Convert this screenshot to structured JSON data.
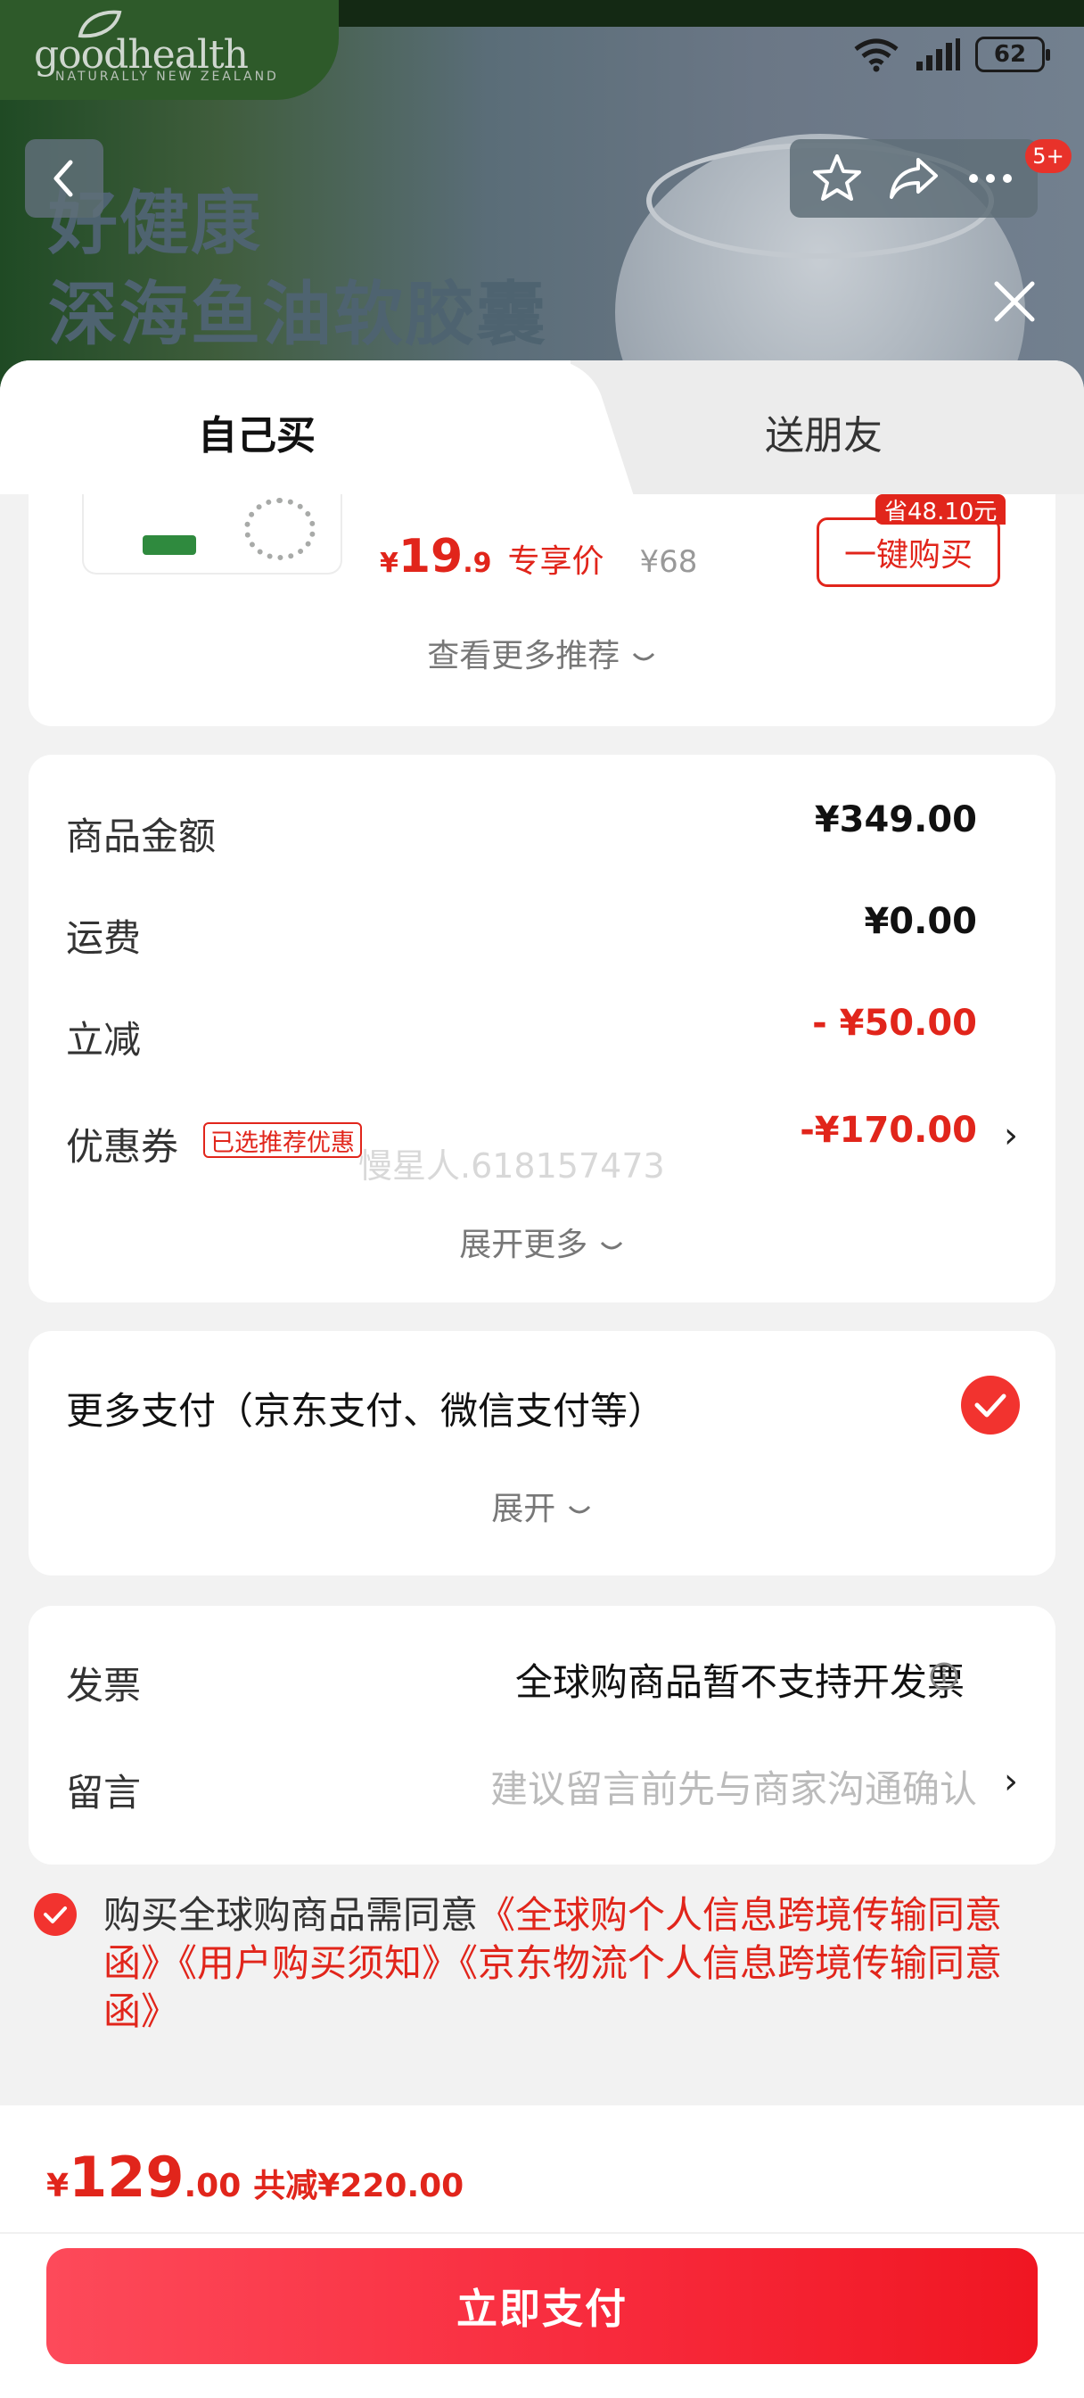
{
  "banner": {
    "brand": "goodhealth",
    "brand_sub": "NATURALLY NEW ZEALAND",
    "headline_line1": "好健康",
    "headline_line2": "深海鱼油软胶囊"
  },
  "status_bar": {
    "battery": "62"
  },
  "nav": {
    "badge": "5+"
  },
  "tabs": [
    {
      "label": "自己买",
      "active": true
    },
    {
      "label": "送朋友",
      "active": false
    }
  ],
  "recommendation": {
    "currency": "¥",
    "price_int": "19",
    "price_dec": ".9",
    "exclusive_label": "专享价",
    "original_price": "¥68",
    "save_tag": "省48.10元",
    "buy_button": "一键购买",
    "more_label": "查看更多推荐"
  },
  "amounts": {
    "rows": [
      {
        "label": "商品金额",
        "value": "¥349.00"
      },
      {
        "label": "运费",
        "value": "¥0.00"
      },
      {
        "label": "立减",
        "value": "- ¥50.00"
      },
      {
        "label": "优惠券",
        "value": "-¥170.00",
        "tag": "已选推荐优惠"
      }
    ],
    "watermark": "慢星人.618157473",
    "expand_label": "展开更多"
  },
  "payment": {
    "title": "更多支付（京东支付、微信支付等）",
    "expand_label": "展开",
    "selected": true
  },
  "invoice": {
    "invoice_label": "发票",
    "invoice_value": "全球购商品暂不支持开发票",
    "message_label": "留言",
    "message_placeholder": "建议留言前先与商家沟通确认"
  },
  "agreement": {
    "prefix": "购买全球购商品需同意",
    "links": "《全球购个人信息跨境传输同意函》《用户购买须知》《京东物流个人信息跨境传输同意函》"
  },
  "footer": {
    "currency": "¥",
    "total_int": "129",
    "total_dec": ".00",
    "saved": "共减¥220.00",
    "pay_button": "立即支付"
  },
  "colors": {
    "accent_red": "#e1251b",
    "button_red": "#f82b3d",
    "check_red": "#f2332f"
  }
}
